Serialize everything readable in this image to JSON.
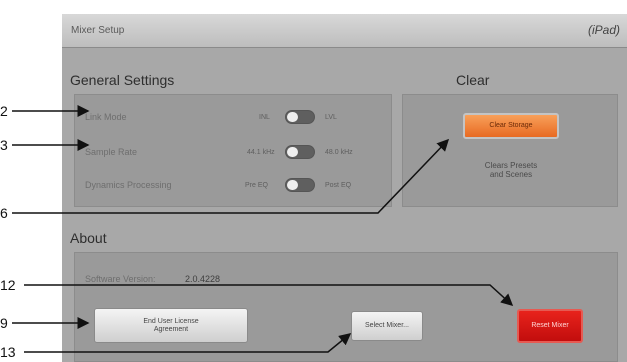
{
  "window": {
    "title": "Mixer Setup",
    "platform_tag": "(iPad)"
  },
  "general_settings": {
    "heading": "General Settings",
    "rows": [
      {
        "label": "Link Mode",
        "left_option": "INL",
        "right_option": "LVL"
      },
      {
        "label": "Sample Rate",
        "left_option": "44.1 kHz",
        "right_option": "48.0 kHz"
      },
      {
        "label": "Dynamics Processing",
        "left_option": "Pre EQ",
        "right_option": "Post EQ"
      }
    ]
  },
  "clear": {
    "heading": "Clear",
    "button_label": "Clear Storage",
    "description_line1": "Clears Presets",
    "description_line2": "and Scenes"
  },
  "about": {
    "heading": "About",
    "version_label": "Software Version:",
    "version_value": "2.0.4228",
    "eula_line1": "End User License",
    "eula_line2": "Agreement",
    "select_mixer_label": "Select Mixer...",
    "reset_mixer_label": "Reset Mixer"
  },
  "callouts": {
    "c2": "2",
    "c3": "3",
    "c6": "6",
    "c12": "12",
    "c9": "9",
    "c13": "13"
  }
}
